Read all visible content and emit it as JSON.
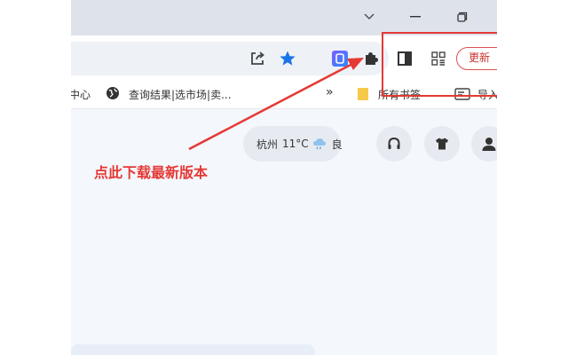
{
  "titlebar": {
    "dropdown_icon": "chevron-down-icon",
    "minimize_icon": "minimize-icon",
    "restore_icon": "restore-icon"
  },
  "toolbar": {
    "share_icon": "share-icon",
    "bookmark_star_icon": "star-icon",
    "star_color": "#1a73e8",
    "extension_app_icon": "app-extension-icon",
    "extensions_icon": "puzzle-icon",
    "side_panel_icon": "side-panel-icon",
    "apps_icon": "grid-apps-icon",
    "update_label": "更新",
    "update_color": "#d9534f"
  },
  "bookmarks_bar": {
    "items": [
      {
        "label": "中心",
        "icon": ""
      },
      {
        "label": "查询结果|选市场|卖...",
        "icon": "globe-icon"
      }
    ],
    "overflow_label": "»",
    "other_bookmarks_label": "所有书签",
    "import_label": "导入"
  },
  "newtab": {
    "weather": {
      "city": "杭州",
      "temperature": "11°C",
      "condition_icon": "cloud-rain-icon",
      "air_quality": "良"
    },
    "buttons": [
      "headphones-icon",
      "tshirt-icon",
      "user-icon"
    ]
  },
  "annotation": {
    "text": "点此下载最新版本",
    "color": "#e53935"
  }
}
